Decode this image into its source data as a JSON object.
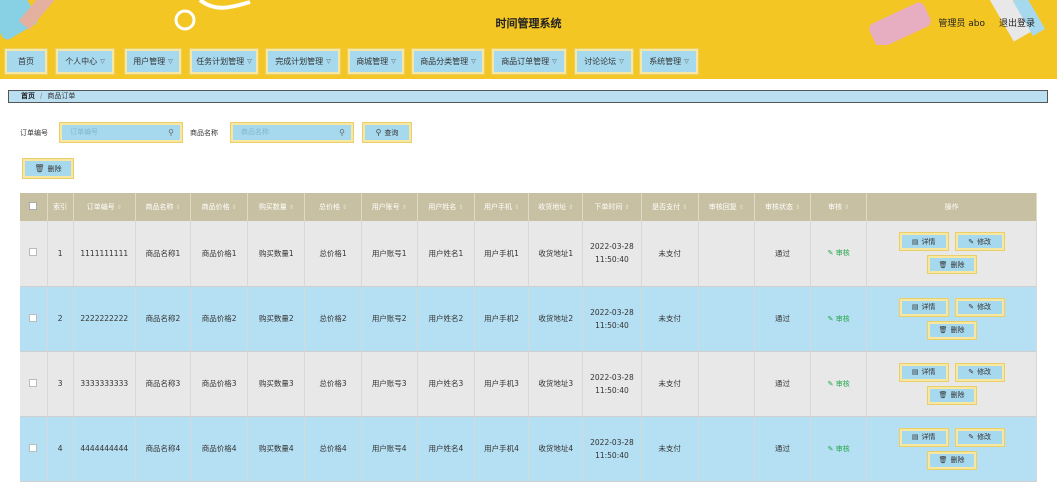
{
  "header": {
    "title": "时间管理系统",
    "user": "管理员 abo",
    "logout": "退出登录"
  },
  "nav": [
    {
      "label": "首页",
      "dropdown": false
    },
    {
      "label": "个人中心",
      "dropdown": true
    },
    {
      "label": "用户管理",
      "dropdown": true
    },
    {
      "label": "任务计划管理",
      "dropdown": true
    },
    {
      "label": "完成计划管理",
      "dropdown": true
    },
    {
      "label": "商城管理",
      "dropdown": true
    },
    {
      "label": "商品分类管理",
      "dropdown": true
    },
    {
      "label": "商品订单管理",
      "dropdown": true
    },
    {
      "label": "讨论论坛",
      "dropdown": true
    },
    {
      "label": "系统管理",
      "dropdown": true
    }
  ],
  "breadcrumb": {
    "home": "首页",
    "current": "商品订单"
  },
  "search": {
    "order_label": "订单编号",
    "order_placeholder": "订单编号",
    "product_label": "商品名称",
    "product_placeholder": "商品名称",
    "query_label": "查询",
    "delete_label": "删除"
  },
  "table": {
    "columns": [
      "索引",
      "订单编号",
      "商品名称",
      "商品价格",
      "购买数量",
      "总价格",
      "用户账号",
      "用户姓名",
      "用户手机",
      "收货地址",
      "下单时间",
      "是否支付",
      "审核回复",
      "审核状态",
      "审核",
      "操作"
    ],
    "rows": [
      {
        "index": "1",
        "order": "1111111111",
        "name": "商品名称1",
        "price": "商品价格1",
        "qty": "购买数量1",
        "total": "总价格1",
        "account": "用户账号1",
        "username": "用户姓名1",
        "phone": "用户手机1",
        "address": "收货地址1",
        "date": "2022-03-28",
        "time": "11:50:40",
        "paid": "未支付",
        "reply": "",
        "status": "通过",
        "review": "审核"
      },
      {
        "index": "2",
        "order": "2222222222",
        "name": "商品名称2",
        "price": "商品价格2",
        "qty": "购买数量2",
        "total": "总价格2",
        "account": "用户账号2",
        "username": "用户姓名2",
        "phone": "用户手机2",
        "address": "收货地址2",
        "date": "2022-03-28",
        "time": "11:50:40",
        "paid": "未支付",
        "reply": "",
        "status": "通过",
        "review": "审核"
      },
      {
        "index": "3",
        "order": "3333333333",
        "name": "商品名称3",
        "price": "商品价格3",
        "qty": "购买数量3",
        "total": "总价格3",
        "account": "用户账号3",
        "username": "用户姓名3",
        "phone": "用户手机3",
        "address": "收货地址3",
        "date": "2022-03-28",
        "time": "11:50:40",
        "paid": "未支付",
        "reply": "",
        "status": "通过",
        "review": "审核"
      },
      {
        "index": "4",
        "order": "4444444444",
        "name": "商品名称4",
        "price": "商品价格4",
        "qty": "购买数量4",
        "total": "总价格4",
        "account": "用户账号4",
        "username": "用户姓名4",
        "phone": "用户手机4",
        "address": "收货地址4",
        "date": "2022-03-28",
        "time": "11:50:40",
        "paid": "未支付",
        "reply": "",
        "status": "通过",
        "review": "审核"
      }
    ],
    "actions": {
      "detail": "详情",
      "edit": "修改",
      "delete": "删除"
    }
  },
  "colors": {
    "header_bg": "#f3c623",
    "button_bg": "#a7d9ee",
    "table_header": "#c8c0a2",
    "row_even": "#b5dff2",
    "row_odd": "#e8e8e8",
    "review_green": "#23a74a"
  },
  "icons": [
    "search-icon",
    "trash-icon",
    "detail-icon",
    "edit-icon",
    "checkbox-icon",
    "sort-icon",
    "chevron-down-icon"
  ]
}
